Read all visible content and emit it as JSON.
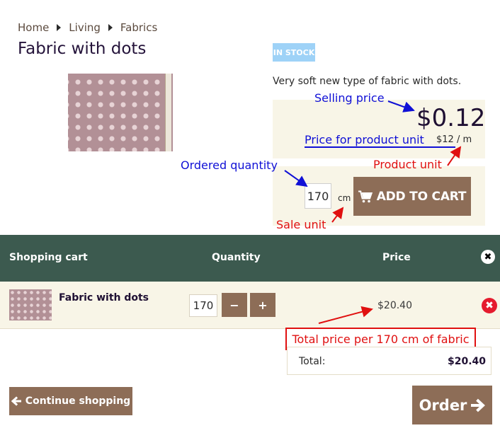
{
  "breadcrumb": [
    "Home",
    "Living",
    "Fabrics"
  ],
  "product": {
    "title": "Fabric with dots",
    "stock_badge": "IN STOCK",
    "description": "Very soft new type of fabric with dots.",
    "selling_price": "$0.12",
    "unit_price": "$12",
    "unit_separator": "/",
    "product_unit": "m",
    "quantity": "170",
    "sale_unit": "cm",
    "add_to_cart_label": "ADD TO CART"
  },
  "annotations": {
    "selling_price": "Selling price",
    "price_for_unit": "Price for product unit",
    "ordered_quantity": "Ordered quantity",
    "product_unit": "Product unit",
    "sale_unit": "Sale unit",
    "total_note": "Total price per 170 cm of fabric"
  },
  "cart": {
    "header": {
      "title": "Shopping cart",
      "quantity": "Quantity",
      "price": "Price"
    },
    "item": {
      "name": "Fabric with dots",
      "quantity": "170",
      "minus": "−",
      "plus": "+",
      "price": "$20.40"
    },
    "total_label": "Total:",
    "total_value": "$20.40",
    "continue_label": "Continue shopping",
    "order_label": "Order"
  },
  "colors": {
    "cart_header": "#3c5a4f",
    "button": "#8d6d57",
    "panel": "#f8f5e7",
    "badge": "#9ed2f7",
    "annotation_blue": "#1010d6",
    "annotation_red": "#e01010"
  },
  "icons": {
    "breadcrumb_separator": "triangle-right-icon",
    "add_to_cart": "cart-icon",
    "close_cart": "close-icon",
    "remove_item": "remove-icon",
    "continue": "arrow-left-icon",
    "order": "arrow-right-icon"
  }
}
